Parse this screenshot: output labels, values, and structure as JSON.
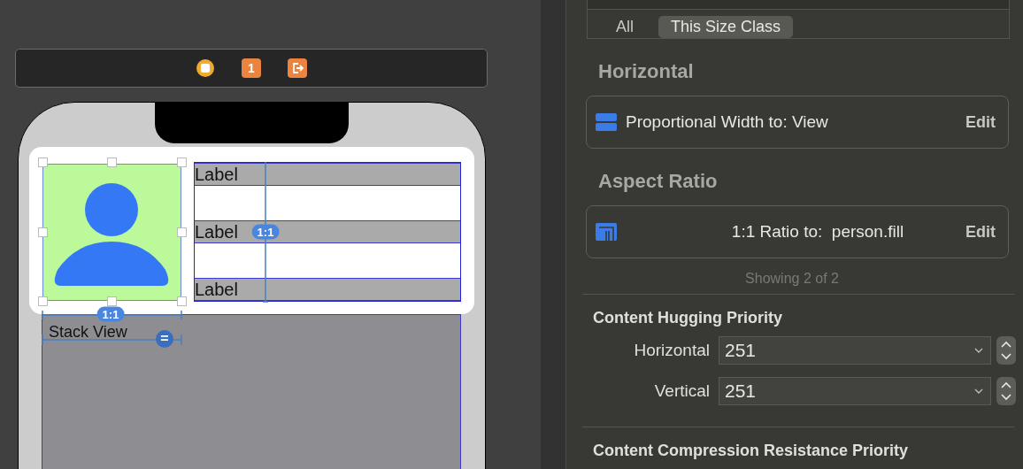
{
  "canvas": {
    "scene_badge": "1",
    "labels": [
      "Label",
      "Label",
      "Label"
    ],
    "stack_view_title": "Stack View",
    "constraint_badges": [
      {
        "kind": "ratio",
        "text": "1:1"
      },
      {
        "kind": "ratio",
        "text": "1:1"
      },
      {
        "kind": "equal",
        "text": "="
      }
    ]
  },
  "inspector": {
    "scope_tabs": [
      {
        "label": "All",
        "selected": false
      },
      {
        "label": "This Size Class",
        "selected": true
      }
    ],
    "sections": [
      {
        "title": "Horizontal",
        "constraints": [
          {
            "kind": "width",
            "text": "Proportional Width to: View",
            "action": "Edit"
          }
        ]
      },
      {
        "title": "Aspect Ratio",
        "constraints": [
          {
            "kind": "aspect",
            "text": "1:1 Ratio to:  person.fill",
            "action": "Edit"
          }
        ]
      }
    ],
    "showing": "Showing 2 of 2",
    "content_hugging": {
      "title": "Content Hugging Priority",
      "rows": [
        {
          "label": "Horizontal",
          "value": "251"
        },
        {
          "label": "Vertical",
          "value": "251"
        }
      ]
    },
    "compression_title": "Content Compression Resistance Priority"
  }
}
